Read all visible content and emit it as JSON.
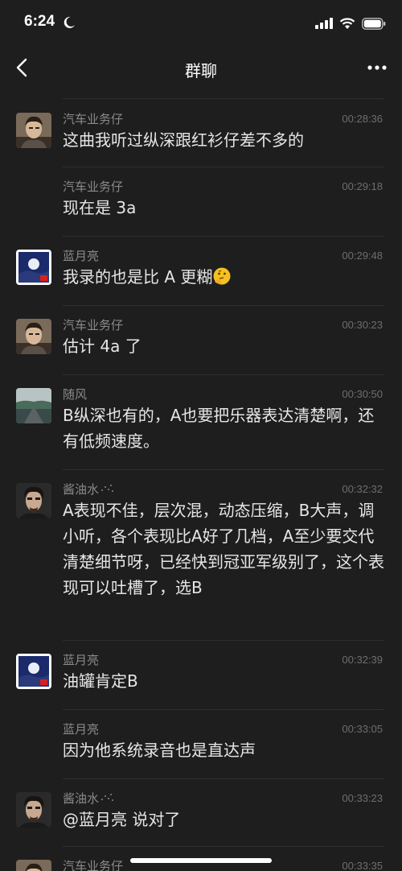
{
  "status": {
    "time": "6:24"
  },
  "nav": {
    "title": "群聊"
  },
  "messages": [
    {
      "sender": "汽车业务仔",
      "time": "00:28:36",
      "text": "这曲我听过纵深跟红衫仔差不多的",
      "avatar": "car-guy"
    },
    {
      "sender": "汽车业务仔",
      "time": "00:29:18",
      "text": "现在是 3a",
      "avatar": ""
    },
    {
      "sender": "蓝月亮",
      "time": "00:29:48",
      "text": "我录的也是比 A 更糊",
      "avatar": "moon"
    },
    {
      "sender": "汽车业务仔",
      "time": "00:30:23",
      "text": "估计 4a 了",
      "avatar": "car-guy"
    },
    {
      "sender": "随风",
      "time": "00:30:50",
      "text": "B纵深也有的，A也要把乐器表达清楚啊，还有低频速度。",
      "avatar": "road"
    },
    {
      "sender": "酱油水",
      "time": "00:32:32",
      "text": "A表现不佳，层次混，动态压缩，B大声，调小听，各个表现比A好了几档，A至少要交代清楚细节呀，已经快到冠亚军级别了，这个表现可以吐槽了，选B",
      "avatar": "man"
    },
    {
      "sender": "蓝月亮",
      "time": "00:32:39",
      "text": "油罐肯定B",
      "avatar": "moon"
    },
    {
      "sender": "蓝月亮",
      "time": "00:33:05",
      "text": "因为他系统录音也是直达声",
      "avatar": ""
    },
    {
      "sender": "酱油水",
      "time": "00:33:23",
      "text": "@蓝月亮 说对了",
      "avatar": "man"
    },
    {
      "sender": "汽车业务仔",
      "time": "00:33:35",
      "text": "",
      "avatar": "car-guy"
    }
  ]
}
